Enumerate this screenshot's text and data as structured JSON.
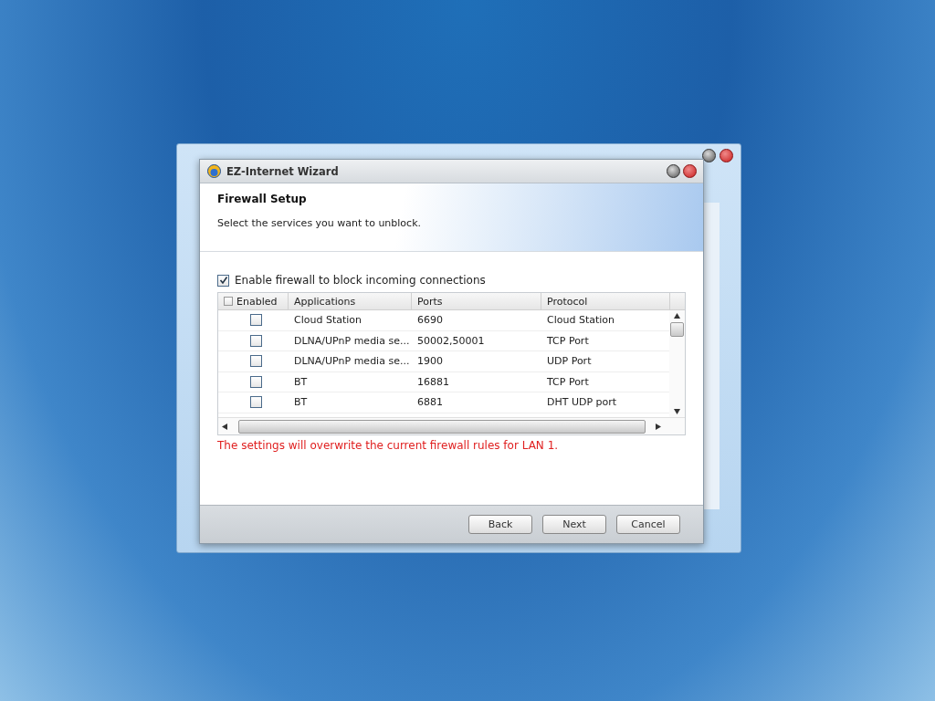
{
  "window": {
    "title": "EZ-Internet Wizard"
  },
  "header": {
    "title": "Firewall Setup",
    "subtitle": "Select the services you want to unblock."
  },
  "firewall_option": {
    "label": "Enable firewall to block incoming connections",
    "checked": true
  },
  "table": {
    "select_all": {
      "label": "Enabled",
      "checked": false
    },
    "columns": [
      "Applications",
      "Ports",
      "Protocol"
    ],
    "rows": [
      {
        "enabled": false,
        "cells": [
          "Cloud Station",
          "6690",
          "Cloud Station"
        ]
      },
      {
        "enabled": false,
        "cells": [
          "DLNA/UPnP media se...",
          "50002,50001",
          "TCP Port"
        ]
      },
      {
        "enabled": false,
        "cells": [
          "DLNA/UPnP media se...",
          "1900",
          "UDP Port"
        ]
      },
      {
        "enabled": false,
        "cells": [
          "BT",
          "16881",
          "TCP Port"
        ]
      },
      {
        "enabled": false,
        "cells": [
          "BT",
          "6881",
          "DHT UDP port"
        ]
      }
    ]
  },
  "warning": "The settings will overwrite the current firewall rules for LAN 1.",
  "buttons": [
    "Back",
    "Next",
    "Cancel"
  ]
}
